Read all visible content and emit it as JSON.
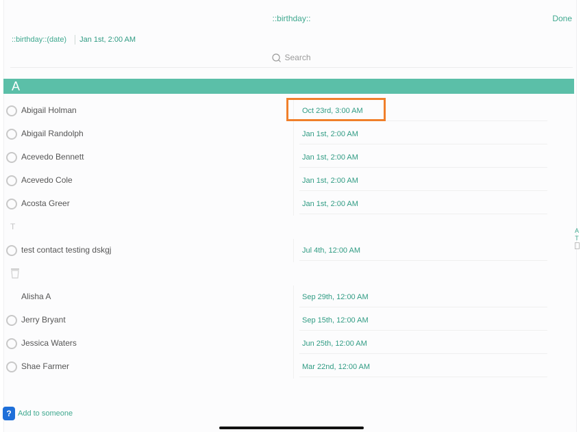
{
  "header": {
    "title": "::birthday::",
    "done_label": "Done"
  },
  "default_field": {
    "label": "::birthday::(date)",
    "value": "Jan 1st, 2:00 AM"
  },
  "search": {
    "placeholder": "Search"
  },
  "section": {
    "letter": "A"
  },
  "contacts_a": [
    {
      "name": "Abigail Holman",
      "date": "Oct 23rd, 3:00 AM"
    },
    {
      "name": "Abigail Randolph",
      "date": "Jan 1st, 2:00 AM"
    },
    {
      "name": "Acevedo Bennett",
      "date": "Jan 1st, 2:00 AM"
    },
    {
      "name": "Acevedo Cole",
      "date": "Jan 1st, 2:00 AM"
    },
    {
      "name": "Acosta Greer",
      "date": "Jan 1st, 2:00 AM"
    }
  ],
  "group_t": {
    "letter": "T",
    "contact": {
      "name": "test contact testing dskgj",
      "date": "Jul 4th, 12:00 AM"
    }
  },
  "trash_group": {
    "icon": "trash-icon",
    "contacts": [
      {
        "name": "Alisha A",
        "date": "Sep 29th, 12:00 AM"
      },
      {
        "name": "Jerry Bryant",
        "date": "Sep 15th, 12:00 AM"
      },
      {
        "name": "Jessica Waters",
        "date": "Jun 25th, 12:00 AM"
      },
      {
        "name": "Shae Farmer",
        "date": "Mar 22nd, 12:00 AM"
      }
    ]
  },
  "index": [
    "A",
    "T"
  ],
  "footer": {
    "badge": "?",
    "label": "Add to someone"
  },
  "colors": {
    "accent": "#3fa88f",
    "section_bg": "#5bbfa8",
    "highlight": "#f07f2a"
  }
}
